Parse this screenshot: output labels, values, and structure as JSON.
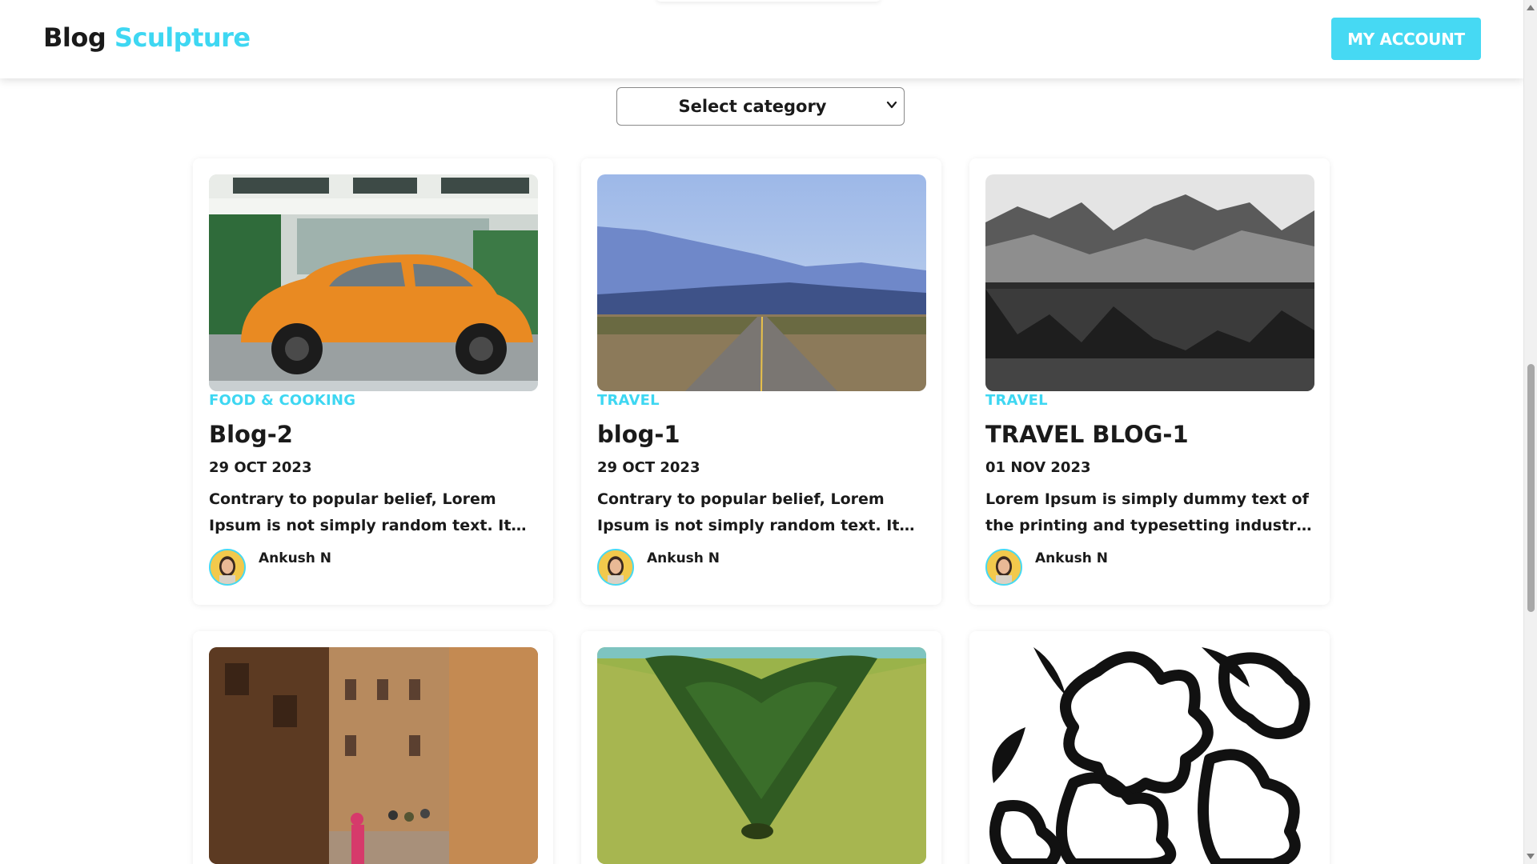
{
  "header": {
    "brand_part1": "Blog",
    "brand_part2": "Sculpture",
    "account_button": "MY ACCOUNT"
  },
  "filter": {
    "selected": "Select category",
    "icon": "chevron-down-icon"
  },
  "colors": {
    "accent": "#46d9f3",
    "text": "#1a1a1a",
    "background": "#ffffff"
  },
  "posts": [
    {
      "category": "FOOD & COOKING",
      "title": "Blog-2",
      "date": "29 OCT 2023",
      "excerpt": "Contrary to popular belief, Lorem Ipsum is not simply random text. It has roots in...",
      "author": "Ankush N",
      "image": "orange-vintage-car"
    },
    {
      "category": "TRAVEL",
      "title": "blog-1",
      "date": "29 OCT 2023",
      "excerpt": "Contrary to popular belief, Lorem Ipsum is not simply random text. It has roots in...",
      "author": "Ankush N",
      "image": "desert-road-mountains"
    },
    {
      "category": "TRAVEL",
      "title": "TRAVEL BLOG-1",
      "date": "01 NOV 2023",
      "excerpt": "Lorem Ipsum is simply dummy text of the printing and typesetting industry. Lore...",
      "author": "Ankush N",
      "image": "mountain-lake-reflection"
    },
    {
      "image": "old-town-street"
    },
    {
      "image": "heart-shaped-forest"
    },
    {
      "image": "black-white-flowers"
    }
  ]
}
